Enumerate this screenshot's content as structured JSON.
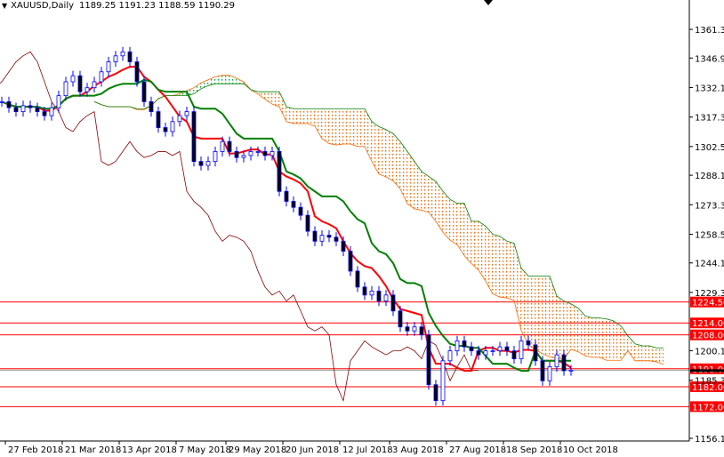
{
  "header": {
    "symbol": "XAUUSD,Daily",
    "ohlc": "1189.25 1191.23 1188.59 1190.29"
  },
  "chart_data": {
    "type": "candlestick",
    "title": "XAUUSD,Daily",
    "ylim": [
      1156.1,
      1361.3
    ],
    "y_ticks": [
      "1361.30",
      "1346.90",
      "1332.10",
      "1317.30",
      "1302.50",
      "1288.10",
      "1273.30",
      "1258.50",
      "1244.10",
      "1229.30",
      "1200.10",
      "1185.30",
      "1156.10"
    ],
    "x_ticks": [
      "27 Feb 2018",
      "21 Mar 2018",
      "13 Apr 2018",
      "7 May 2018",
      "29 May 2018",
      "20 Jun 2018",
      "12 Jul 2018",
      "3 Aug 2018",
      "27 Aug 2018",
      "18 Sep 2018",
      "10 Oct 2018"
    ],
    "x_tick_index": [
      3,
      11,
      19,
      27,
      34,
      42,
      50,
      57,
      65,
      73,
      81
    ],
    "closes": [
      1325,
      1322,
      1320,
      1323,
      1322,
      1320,
      1318,
      1322,
      1328,
      1335,
      1338,
      1330,
      1332,
      1335,
      1340,
      1345,
      1348,
      1350,
      1345,
      1335,
      1325,
      1320,
      1312,
      1310,
      1315,
      1318,
      1320,
      1295,
      1293,
      1295,
      1300,
      1305,
      1300,
      1297,
      1298,
      1300,
      1300,
      1298,
      1300,
      1280,
      1275,
      1272,
      1268,
      1260,
      1255,
      1258,
      1257,
      1255,
      1250,
      1240,
      1232,
      1228,
      1230,
      1225,
      1228,
      1220,
      1212,
      1210,
      1212,
      1208,
      1183,
      1175,
      1195,
      1200,
      1205,
      1202,
      1200,
      1198,
      1200,
      1200,
      1202,
      1200,
      1196,
      1205,
      1203,
      1195,
      1185,
      1192,
      1198,
      1190,
      1190.29
    ],
    "indicator": "Ichimoku",
    "levels": [
      {
        "value": 1224.5,
        "label": "1224.50"
      },
      {
        "value": 1214.0,
        "label": "1214.00"
      },
      {
        "value": 1208.0,
        "label": "1208.00"
      },
      {
        "value": 1191.0,
        "label": "1191.00"
      },
      {
        "value": 1182.0,
        "label": "1182.00"
      },
      {
        "value": 1172.0,
        "label": "1172.00"
      }
    ],
    "current_price": 1190.29,
    "colors": {
      "level": "#ff0000",
      "tenkan": "#ff0000",
      "kijun": "#008000",
      "chikou": "#8b0000",
      "cloud_bear": "#ff6600",
      "cloud_bull": "#00aa44",
      "candle": "#0000ff"
    }
  }
}
